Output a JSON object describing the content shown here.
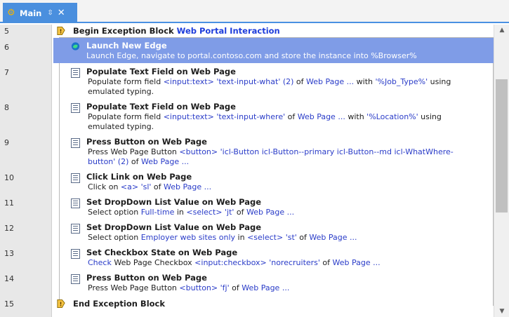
{
  "tab": {
    "title": "Main",
    "pin_glyph": "⇳",
    "close_glyph": "✕",
    "icon": "gear-icon"
  },
  "rows": [
    {
      "line": "5",
      "title": "Begin Exception Block",
      "name": "Web Portal Interaction",
      "icon": "exception-block-icon"
    },
    {
      "line": "6",
      "title": "Launch New Edge",
      "desc": "Launch Edge, navigate to portal.contoso.com and store the instance into %Browser%",
      "icon": "edge-icon",
      "selected": true
    },
    {
      "line": "7",
      "title": "Populate Text Field on Web Page",
      "desc_parts": [
        "Populate form field ",
        "<input:text> 'text-input-what' (2)",
        " of ",
        "Web Page  ...",
        " with ",
        "'%Job_Type%'",
        " using"
      ],
      "desc2": "emulated typing.",
      "icon": "text-field-icon"
    },
    {
      "line": "8",
      "title": "Populate Text Field on Web Page",
      "desc_parts": [
        "Populate form field ",
        "<input:text> 'text-input-where'",
        " of ",
        "Web Page  ...",
        " with ",
        "'%Location%'",
        " using"
      ],
      "desc2": "emulated typing.",
      "icon": "text-field-icon"
    },
    {
      "line": "9",
      "title": "Press Button on Web Page",
      "desc_parts": [
        "Press Web Page Button ",
        "<button> 'icl-Button icl-Button--primary icl-Button--md icl-WhatWhere-"
      ],
      "desc2_parts": [
        "button' (2)",
        " of ",
        "Web Page  ..."
      ],
      "icon": "button-icon"
    },
    {
      "line": "10",
      "title": "Click Link on Web Page",
      "desc_parts": [
        "Click on ",
        "<a> 'sl'",
        " of ",
        "Web Page  ..."
      ],
      "icon": "link-icon"
    },
    {
      "line": "11",
      "title": "Set DropDown List Value on Web Page",
      "desc_parts": [
        "Select option ",
        "Full-time",
        " in ",
        "<select> 'jt'",
        " of ",
        "Web Page  ..."
      ],
      "icon": "dropdown-icon"
    },
    {
      "line": "12",
      "title": "Set DropDown List Value on Web Page",
      "desc_parts": [
        "Select option ",
        "Employer web sites only",
        " in ",
        "<select> 'st'",
        " of ",
        "Web Page  ..."
      ],
      "icon": "dropdown-icon"
    },
    {
      "line": "13",
      "title": "Set Checkbox State on Web Page",
      "desc_parts": [
        "Check",
        " Web Page Checkbox ",
        "<input:checkbox> 'norecruiters'",
        " of ",
        "Web Page  ..."
      ],
      "icon": "checkbox-icon"
    },
    {
      "line": "14",
      "title": "Press Button on Web Page",
      "desc_parts": [
        "Press Web Page Button ",
        "<button> 'fj'",
        " of ",
        "Web Page  ..."
      ],
      "icon": "button-icon"
    },
    {
      "line": "15",
      "title": "End Exception Block",
      "icon": "exception-block-icon"
    }
  ],
  "colors": {
    "accent": "#4a8fde",
    "selection": "#7f9ce7",
    "link": "#2a3cc8"
  }
}
